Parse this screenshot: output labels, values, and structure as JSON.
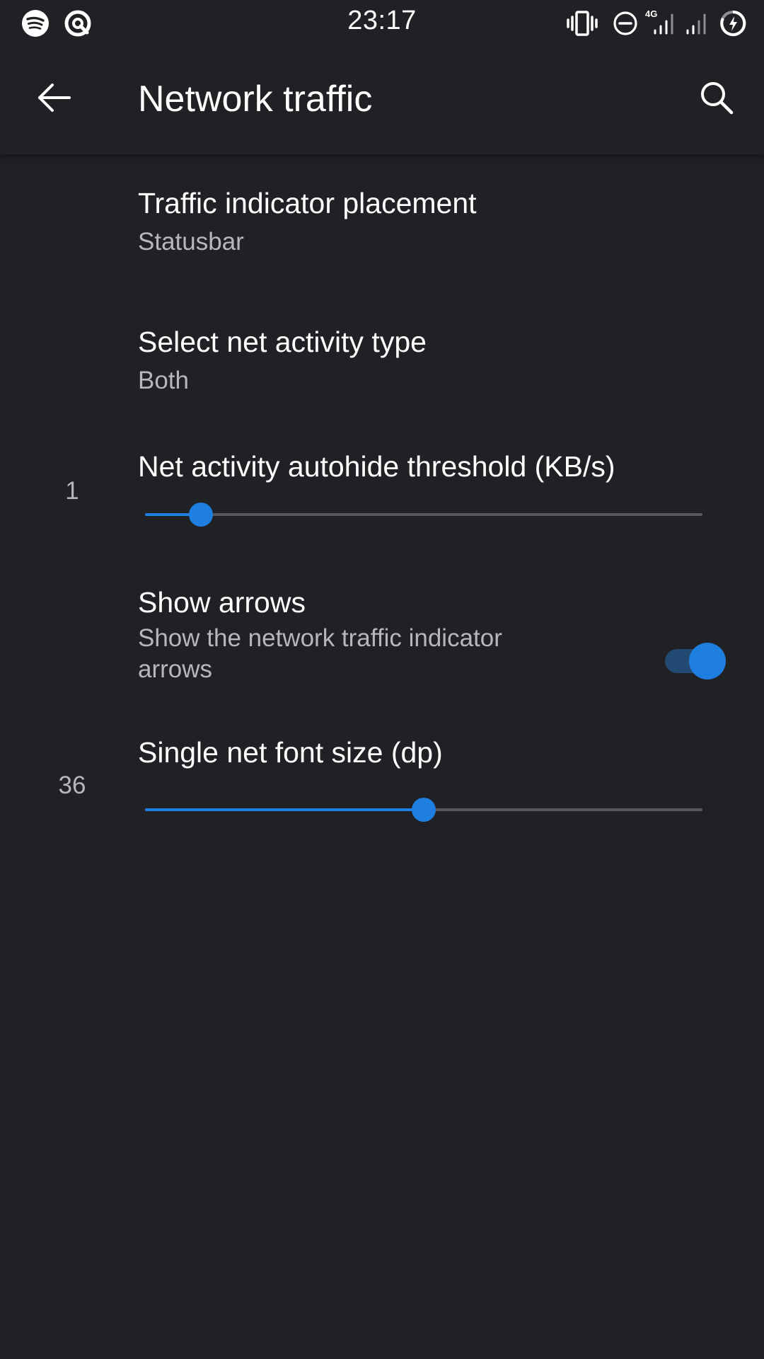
{
  "status_bar": {
    "time": "23:17",
    "network_type": "4G",
    "left_icons": [
      "spotify-icon",
      "quickstep-icon"
    ],
    "right_icons": [
      "vibrate-icon",
      "do-not-disturb-icon",
      "signal-icon",
      "signal-icon-2",
      "battery-charging-icon"
    ]
  },
  "app_bar": {
    "title": "Network traffic",
    "back_icon": "arrow-back-icon",
    "search_icon": "search-icon"
  },
  "preferences": {
    "placement": {
      "title": "Traffic indicator placement",
      "summary": "Statusbar"
    },
    "activity_type": {
      "title": "Select net activity type",
      "summary": "Both"
    },
    "autohide": {
      "title": "Net activity autohide threshold (KB/s)",
      "value": "1",
      "fraction": 0.1
    },
    "show_arrows": {
      "title": "Show arrows",
      "summary": "Show the network traffic indicator arrows",
      "checked": true
    },
    "font_size": {
      "title": "Single net font size (dp)",
      "value": "36",
      "fraction": 0.5
    }
  },
  "colors": {
    "background": "#202125",
    "accent": "#1f7fe0",
    "summary_text": "#b5b7bb",
    "track_inactive": "#56585d",
    "switch_track_on": "#234a73"
  }
}
